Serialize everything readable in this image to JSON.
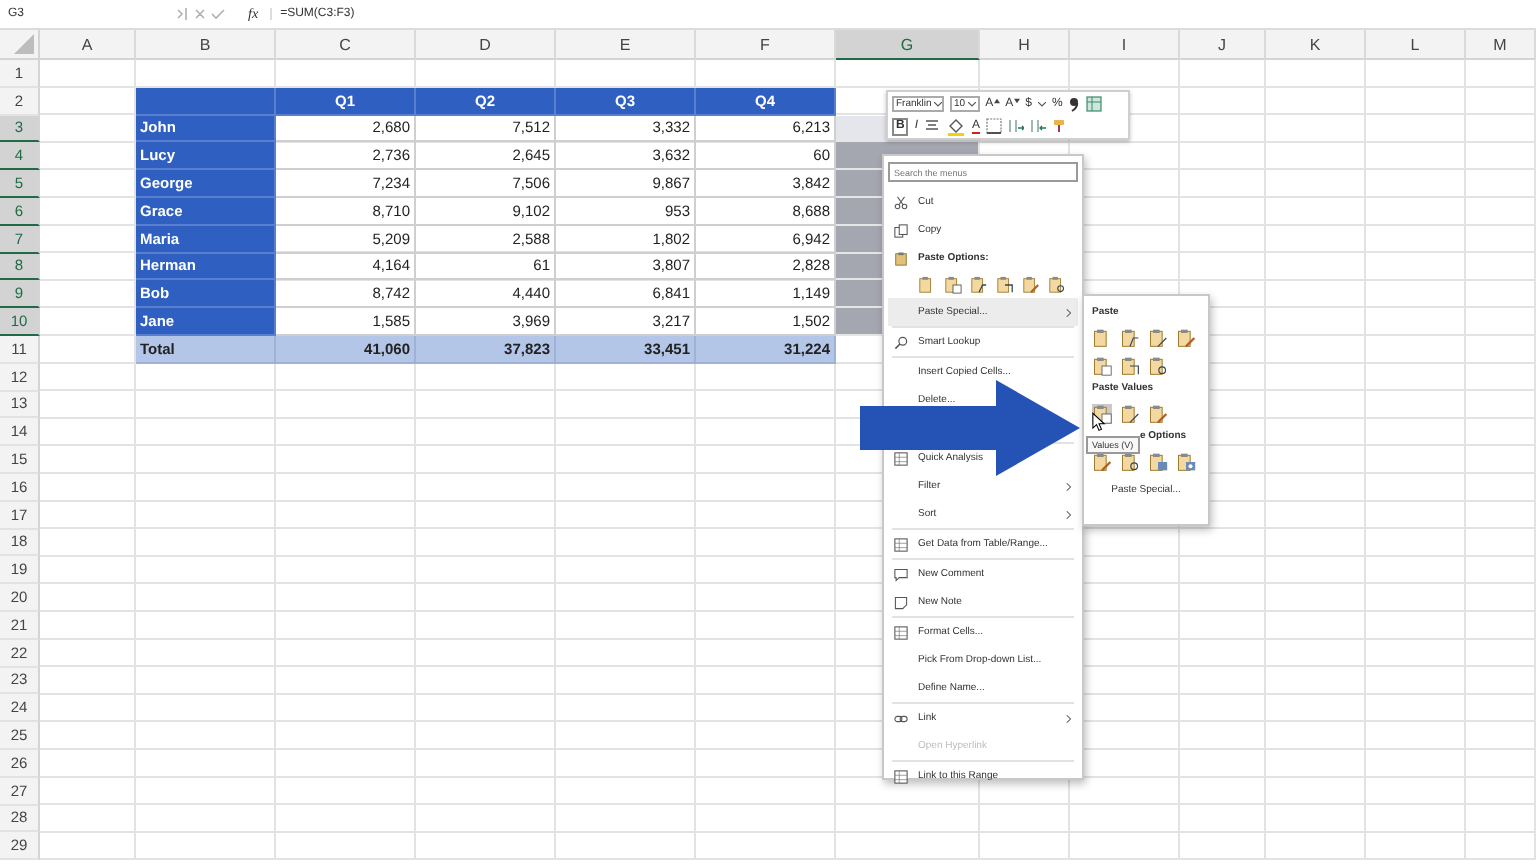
{
  "formula_bar": {
    "name_box": "G3",
    "fx": "fx",
    "formula": "=SUM(C3:F3)"
  },
  "column_headers": [
    {
      "label": "A",
      "selected": false
    },
    {
      "label": "B",
      "selected": false
    },
    {
      "label": "C",
      "selected": false
    },
    {
      "label": "D",
      "selected": false
    },
    {
      "label": "E",
      "selected": false
    },
    {
      "label": "F",
      "selected": false
    },
    {
      "label": "G",
      "selected": true
    },
    {
      "label": "H",
      "selected": false
    },
    {
      "label": "I",
      "selected": false
    },
    {
      "label": "J",
      "selected": false
    },
    {
      "label": "K",
      "selected": false
    },
    {
      "label": "L",
      "selected": false
    },
    {
      "label": "M",
      "selected": false
    }
  ],
  "row_headers": [
    {
      "label": "1",
      "selected": false
    },
    {
      "label": "2",
      "selected": false
    },
    {
      "label": "3",
      "selected": true
    },
    {
      "label": "4",
      "selected": true
    },
    {
      "label": "5",
      "selected": true
    },
    {
      "label": "6",
      "selected": true
    },
    {
      "label": "7",
      "selected": true
    },
    {
      "label": "8",
      "selected": true
    },
    {
      "label": "9",
      "selected": true
    },
    {
      "label": "10",
      "selected": true
    },
    {
      "label": "11",
      "selected": false
    },
    {
      "label": "12",
      "selected": false
    },
    {
      "label": "13",
      "selected": false
    },
    {
      "label": "14",
      "selected": false
    },
    {
      "label": "15",
      "selected": false
    },
    {
      "label": "16",
      "selected": false
    },
    {
      "label": "17",
      "selected": false
    },
    {
      "label": "18",
      "selected": false
    },
    {
      "label": "19",
      "selected": false
    },
    {
      "label": "20",
      "selected": false
    },
    {
      "label": "21",
      "selected": false
    },
    {
      "label": "22",
      "selected": false
    },
    {
      "label": "23",
      "selected": false
    },
    {
      "label": "24",
      "selected": false
    },
    {
      "label": "25",
      "selected": false
    },
    {
      "label": "26",
      "selected": false
    },
    {
      "label": "27",
      "selected": false
    },
    {
      "label": "28",
      "selected": false
    },
    {
      "label": "29",
      "selected": false
    }
  ],
  "table": {
    "columns": [
      "Q1",
      "Q2",
      "Q3",
      "Q4"
    ],
    "rows": [
      {
        "name": "John",
        "values": [
          "2,680",
          "7,512",
          "3,332",
          "6,213"
        ]
      },
      {
        "name": "Lucy",
        "values": [
          "2,736",
          "2,645",
          "3,632",
          "60"
        ]
      },
      {
        "name": "George",
        "values": [
          "7,234",
          "7,506",
          "9,867",
          "3,842"
        ]
      },
      {
        "name": "Grace",
        "values": [
          "8,710",
          "9,102",
          "953",
          "8,688"
        ]
      },
      {
        "name": "Maria",
        "values": [
          "5,209",
          "2,588",
          "1,802",
          "6,942"
        ]
      },
      {
        "name": "Herman",
        "values": [
          "4,164",
          "61",
          "3,807",
          "2,828"
        ]
      },
      {
        "name": "Bob",
        "values": [
          "8,742",
          "4,440",
          "6,841",
          "1,149"
        ]
      },
      {
        "name": "Jane",
        "values": [
          "1,585",
          "3,969",
          "3,217",
          "1,502"
        ]
      }
    ],
    "total": {
      "label": "Total",
      "values": [
        "41,060",
        "37,823",
        "33,451",
        "31,224"
      ]
    }
  },
  "mini_toolbar": {
    "font": "Franklin",
    "size": "10",
    "row1": [
      {
        "kind": "grow",
        "label": "A"
      },
      {
        "kind": "shrink",
        "label": "A"
      },
      {
        "kind": "text",
        "label": "$"
      },
      {
        "kind": "caret"
      },
      {
        "kind": "text",
        "label": "%"
      },
      {
        "kind": "comma"
      },
      {
        "kind": "format"
      }
    ],
    "row2": [
      {
        "kind": "bold",
        "label": "B"
      },
      {
        "kind": "italic",
        "label": "I"
      },
      {
        "kind": "align"
      },
      {
        "kind": "fill"
      },
      {
        "kind": "fontcolor",
        "label": "A"
      },
      {
        "kind": "borders"
      },
      {
        "kind": "more-decimals"
      },
      {
        "kind": "less-decimals"
      },
      {
        "kind": "painter"
      }
    ]
  },
  "context_menu": {
    "search": {
      "placeholder": "Search the menus"
    },
    "entries": [
      {
        "kind": "cut",
        "label": "Cut",
        "submenu": false,
        "disabled": false,
        "selected": false
      },
      {
        "kind": "copy",
        "label": "Copy",
        "submenu": false,
        "disabled": false,
        "selected": false
      },
      {
        "kind": "heading",
        "label": "Paste Options:"
      },
      {
        "kind": "paste-icons",
        "icons": [
          {
            "kind": "plain"
          },
          {
            "kind": "values"
          },
          {
            "kind": "formula"
          },
          {
            "kind": "transpose"
          },
          {
            "kind": "format"
          },
          {
            "kind": "link"
          }
        ]
      },
      {
        "kind": "plain",
        "label": "Paste Special...",
        "submenu": true,
        "disabled": false,
        "selected": true
      },
      {
        "kind": "separator"
      },
      {
        "kind": "lookup",
        "label": "Smart Lookup",
        "submenu": false,
        "disabled": false,
        "selected": false
      },
      {
        "kind": "separator"
      },
      {
        "kind": "plain",
        "label": "Insert Copied Cells...",
        "submenu": false,
        "disabled": false,
        "selected": false
      },
      {
        "kind": "plain",
        "label": "Delete...",
        "submenu": false,
        "disabled": false,
        "selected": false
      },
      {
        "kind": "gap"
      },
      {
        "kind": "separator"
      },
      {
        "kind": "analysis",
        "label": "Quick Analysis",
        "submenu": false,
        "disabled": false,
        "selected": false
      },
      {
        "kind": "plain",
        "label": "Filter",
        "submenu": true,
        "disabled": false,
        "selected": false
      },
      {
        "kind": "plain",
        "label": "Sort",
        "submenu": true,
        "disabled": false,
        "selected": false
      },
      {
        "kind": "separator"
      },
      {
        "kind": "getdata",
        "label": "Get Data from Table/Range...",
        "submenu": false,
        "disabled": false,
        "selected": false
      },
      {
        "kind": "separator"
      },
      {
        "kind": "comment",
        "label": "New Comment",
        "submenu": false,
        "disabled": false,
        "selected": false
      },
      {
        "kind": "note",
        "label": "New Note",
        "submenu": false,
        "disabled": false,
        "selected": false
      },
      {
        "kind": "separator"
      },
      {
        "kind": "format",
        "label": "Format Cells...",
        "submenu": false,
        "disabled": false,
        "selected": false
      },
      {
        "kind": "plain",
        "label": "Pick From Drop-down List...",
        "submenu": false,
        "disabled": false,
        "selected": false
      },
      {
        "kind": "plain",
        "label": "Define Name...",
        "submenu": false,
        "disabled": false,
        "selected": false
      },
      {
        "kind": "separator"
      },
      {
        "kind": "link",
        "label": "Link",
        "submenu": true,
        "disabled": false,
        "selected": false
      },
      {
        "kind": "plain",
        "label": "Open Hyperlink",
        "submenu": false,
        "disabled": true,
        "selected": false
      },
      {
        "kind": "separator"
      },
      {
        "kind": "linkrange",
        "label": "Link to this Range",
        "submenu": false,
        "disabled": false,
        "selected": false
      }
    ]
  },
  "paste_submenu": {
    "sections": [
      {
        "title": "Paste",
        "icons": [
          {
            "kind": "plain",
            "selected": false
          },
          {
            "kind": "formula",
            "selected": false
          },
          {
            "kind": "percent",
            "selected": false
          },
          {
            "kind": "format",
            "selected": false
          },
          {
            "kind": "values",
            "selected": false
          },
          {
            "kind": "transpose",
            "selected": false
          },
          {
            "kind": "link",
            "selected": false
          }
        ]
      },
      {
        "title": "Paste Values",
        "icons": [
          {
            "kind": "values",
            "selected": true
          },
          {
            "kind": "percent",
            "selected": false
          },
          {
            "kind": "format",
            "selected": false
          }
        ]
      },
      {
        "title": "e Options",
        "icons": [
          {
            "kind": "format",
            "selected": false
          },
          {
            "kind": "link",
            "selected": false
          },
          {
            "kind": "picture",
            "selected": false
          },
          {
            "kind": "linkpic",
            "selected": false
          }
        ]
      }
    ],
    "footer": "Paste Special...",
    "tooltip": "Values (V)"
  }
}
